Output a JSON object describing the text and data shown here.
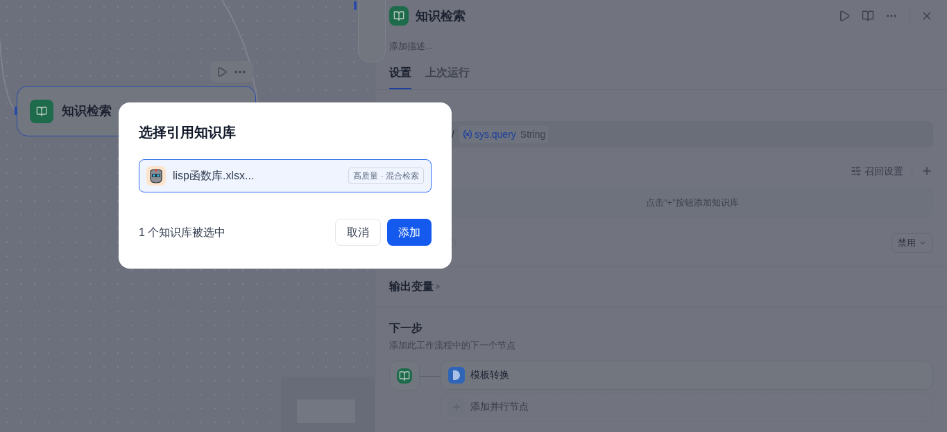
{
  "canvas": {
    "node": {
      "title": "知识检索"
    }
  },
  "modal": {
    "title": "选择引用知识库",
    "items": [
      {
        "name": "lisp函数库.xlsx...",
        "tag": "高质量 · 混合检索",
        "selected": true
      }
    ],
    "count_text": "1 个知识库被选中",
    "buttons": [
      {
        "label": "取消",
        "kind": "secondary"
      },
      {
        "label": "添加",
        "kind": "primary"
      }
    ]
  },
  "panel": {
    "title": "知识检索",
    "description_placeholder": "添加描述...",
    "tabs": [
      {
        "label": "设置",
        "selected": true
      },
      {
        "label": "上次运行",
        "selected": false
      }
    ],
    "query_separator": "/",
    "query_variable": "sys.query",
    "query_type": "String",
    "recall_settings": "召回设置",
    "empty_hint": "点击“+”按钮添加知识库",
    "select_value": "禁用",
    "output_title": "输出变量",
    "next_step": {
      "title": "下一步",
      "subtitle": "添加此工作流程中的下一个节点",
      "next_node": "模板转换",
      "add_parallel": "添加并行节点"
    }
  }
}
